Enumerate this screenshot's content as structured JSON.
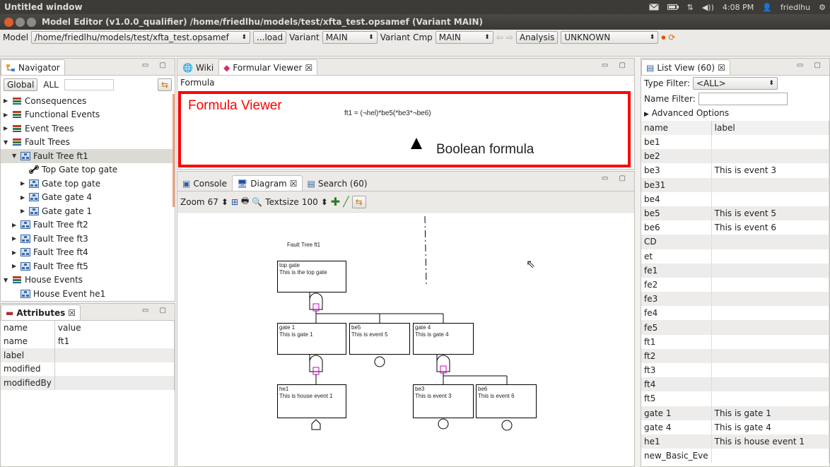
{
  "desktop": {
    "window_title": "Untitled window",
    "clock": "4:08 PM",
    "user": "friedlhu"
  },
  "window": {
    "title": "Model Editor (v1.0.0_qualifier)  /home/friedlhu/models/test/xfta_test.opsamef  (Variant MAIN)"
  },
  "toolbar": {
    "model_label": "Model",
    "model_path": "/home/friedlhu/models/test/xfta_test.opsamef",
    "load_label": "...load",
    "variant_label": "Variant",
    "variant_value": "MAIN",
    "variant_cmp_label": "Variant Cmp",
    "variant_cmp_value": "MAIN",
    "analysis_label": "Analysis",
    "analysis_value": "UNKNOWN"
  },
  "navigator": {
    "title": "Navigator",
    "global": "Global",
    "all": "ALL",
    "items": [
      {
        "label": "Consequences",
        "indent": 0,
        "tw": "▶",
        "icon": "list"
      },
      {
        "label": "Functional Events",
        "indent": 0,
        "tw": "▶",
        "icon": "list"
      },
      {
        "label": "Event Trees",
        "indent": 0,
        "tw": "▶",
        "icon": "list"
      },
      {
        "label": "Fault Trees",
        "indent": 0,
        "tw": "▼",
        "icon": "list"
      },
      {
        "label": "Fault Tree ft1",
        "indent": 1,
        "tw": "▼",
        "icon": "ft",
        "sel": true
      },
      {
        "label": "Top Gate top gate",
        "indent": 2,
        "tw": "",
        "icon": "link"
      },
      {
        "label": "Gate top gate",
        "indent": 2,
        "tw": "▶",
        "icon": "ft"
      },
      {
        "label": "Gate gate 4",
        "indent": 2,
        "tw": "▶",
        "icon": "ft"
      },
      {
        "label": "Gate gate 1",
        "indent": 2,
        "tw": "▶",
        "icon": "ft"
      },
      {
        "label": "Fault Tree ft2",
        "indent": 1,
        "tw": "▶",
        "icon": "ft"
      },
      {
        "label": "Fault Tree ft3",
        "indent": 1,
        "tw": "▶",
        "icon": "ft"
      },
      {
        "label": "Fault Tree ft4",
        "indent": 1,
        "tw": "▶",
        "icon": "ft"
      },
      {
        "label": "Fault Tree ft5",
        "indent": 1,
        "tw": "▶",
        "icon": "ft"
      },
      {
        "label": "House Events",
        "indent": 0,
        "tw": "▼",
        "icon": "list"
      },
      {
        "label": "House Event he1",
        "indent": 1,
        "tw": "",
        "icon": "ft"
      }
    ]
  },
  "attributes": {
    "title": "Attributes",
    "col_name": "name",
    "col_value": "value",
    "rows": [
      {
        "name": "name",
        "value": "ft1"
      },
      {
        "name": "label",
        "value": ""
      },
      {
        "name": "modified",
        "value": ""
      },
      {
        "name": "modifiedBy",
        "value": ""
      }
    ]
  },
  "editor_tabs": {
    "wiki": "Wiki",
    "formular_viewer": "Formular Viewer"
  },
  "formula": {
    "header": "Formula",
    "text": "ft1 = (¬hel)*be5(*be3*¬be6)",
    "annotation_title": "Formula Viewer",
    "annotation_arrow": "Boolean formula"
  },
  "bottom_tabs": {
    "console": "Console",
    "diagram": "Diagram",
    "search": "Search (60)"
  },
  "diagram_toolbar": {
    "zoom_label": "Zoom",
    "zoom": "67",
    "textsize_label": "Textsize",
    "textsize": "100"
  },
  "diagram": {
    "title": "Fault Tree ft1",
    "top": {
      "name": "top gate",
      "desc": "This is the top gate"
    },
    "gate1": {
      "name": "gate 1",
      "desc": "This is gate 1"
    },
    "be5": {
      "name": "be5",
      "desc": "This is event 5"
    },
    "gate4": {
      "name": "gate 4",
      "desc": "This is gate 4"
    },
    "he1": {
      "name": "he1",
      "desc": "This is house event 1"
    },
    "be3": {
      "name": "be3",
      "desc": "This is event 3"
    },
    "be6": {
      "name": "be6",
      "desc": "This is event 6"
    }
  },
  "listview": {
    "title": "List View (60)",
    "type_filter_label": "Type Filter:",
    "type_filter": "<ALL>",
    "name_filter_label": "Name Filter:",
    "advanced": "Advanced Options",
    "col_name": "name",
    "col_label": "label",
    "rows": [
      {
        "name": "be1",
        "label": ""
      },
      {
        "name": "be2",
        "label": ""
      },
      {
        "name": "be3",
        "label": "This is event 3"
      },
      {
        "name": "be31",
        "label": ""
      },
      {
        "name": "be4",
        "label": ""
      },
      {
        "name": "be5",
        "label": "This is event 5"
      },
      {
        "name": "be6",
        "label": "This is event 6"
      },
      {
        "name": "CD",
        "label": ""
      },
      {
        "name": "et",
        "label": ""
      },
      {
        "name": "fe1",
        "label": ""
      },
      {
        "name": "fe2",
        "label": ""
      },
      {
        "name": "fe3",
        "label": ""
      },
      {
        "name": "fe4",
        "label": ""
      },
      {
        "name": "fe5",
        "label": ""
      },
      {
        "name": "ft1",
        "label": ""
      },
      {
        "name": "ft2",
        "label": ""
      },
      {
        "name": "ft3",
        "label": ""
      },
      {
        "name": "ft4",
        "label": ""
      },
      {
        "name": "ft5",
        "label": ""
      },
      {
        "name": "gate 1",
        "label": "This is gate 1"
      },
      {
        "name": "gate 4",
        "label": "This is gate 4"
      },
      {
        "name": "he1",
        "label": "This is house event 1"
      },
      {
        "name": "new_Basic_Eve",
        "label": ""
      }
    ]
  },
  "colors": {
    "accent_red": "#ff0000",
    "ubuntu_dark": "#3c3b37",
    "selection": "#dcdad5",
    "gate_magenta": "#cc00cc"
  }
}
